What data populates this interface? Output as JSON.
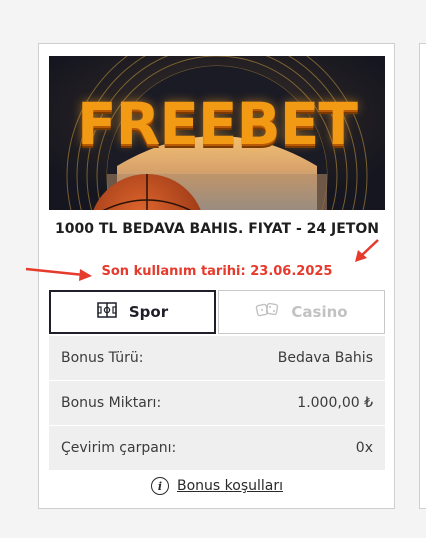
{
  "bonus": {
    "banner_text": "FREEBET",
    "title": "1000 TL BEDAVA BAHIS. FIYAT - 24 JETON",
    "expiry": "Son kullanım tarihi: 23.06.2025"
  },
  "tabs": [
    {
      "label": "Spor",
      "icon": "stadium-icon",
      "active": true
    },
    {
      "label": "Casino",
      "icon": "dice-icon",
      "active": false
    }
  ],
  "details": [
    {
      "label": "Bonus Türü:",
      "value": "Bedava Bahis"
    },
    {
      "label": "Bonus Miktarı:",
      "value": "1.000,00 ₺"
    },
    {
      "label": "Çevirim çarpanı:",
      "value": "0x"
    }
  ],
  "terms": {
    "label": "Bonus koşulları",
    "icon": "info-icon"
  },
  "colors": {
    "accent_red": "#e53a2c",
    "dark": "#1f1f2a",
    "banner_orange": "#f39a14"
  }
}
